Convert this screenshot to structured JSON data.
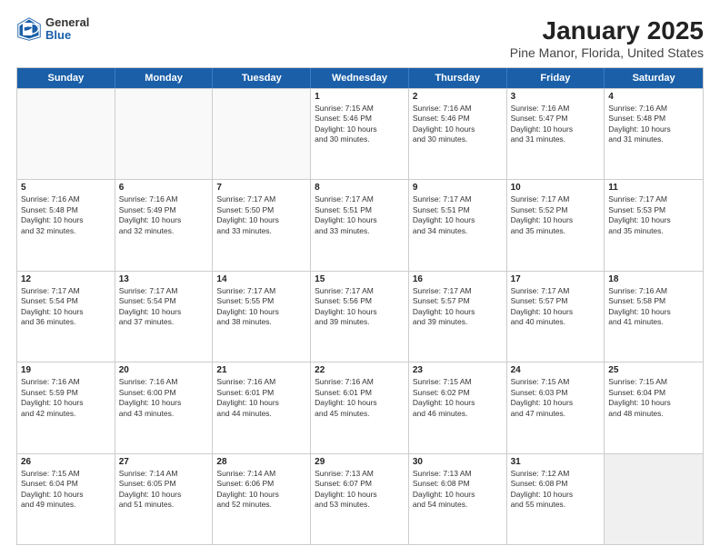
{
  "logo": {
    "general": "General",
    "blue": "Blue"
  },
  "header": {
    "title": "January 2025",
    "subtitle": "Pine Manor, Florida, United States"
  },
  "days": [
    "Sunday",
    "Monday",
    "Tuesday",
    "Wednesday",
    "Thursday",
    "Friday",
    "Saturday"
  ],
  "rows": [
    [
      {
        "day": "",
        "lines": []
      },
      {
        "day": "",
        "lines": []
      },
      {
        "day": "",
        "lines": []
      },
      {
        "day": "1",
        "lines": [
          "Sunrise: 7:15 AM",
          "Sunset: 5:46 PM",
          "Daylight: 10 hours",
          "and 30 minutes."
        ]
      },
      {
        "day": "2",
        "lines": [
          "Sunrise: 7:16 AM",
          "Sunset: 5:46 PM",
          "Daylight: 10 hours",
          "and 30 minutes."
        ]
      },
      {
        "day": "3",
        "lines": [
          "Sunrise: 7:16 AM",
          "Sunset: 5:47 PM",
          "Daylight: 10 hours",
          "and 31 minutes."
        ]
      },
      {
        "day": "4",
        "lines": [
          "Sunrise: 7:16 AM",
          "Sunset: 5:48 PM",
          "Daylight: 10 hours",
          "and 31 minutes."
        ]
      }
    ],
    [
      {
        "day": "5",
        "lines": [
          "Sunrise: 7:16 AM",
          "Sunset: 5:48 PM",
          "Daylight: 10 hours",
          "and 32 minutes."
        ]
      },
      {
        "day": "6",
        "lines": [
          "Sunrise: 7:16 AM",
          "Sunset: 5:49 PM",
          "Daylight: 10 hours",
          "and 32 minutes."
        ]
      },
      {
        "day": "7",
        "lines": [
          "Sunrise: 7:17 AM",
          "Sunset: 5:50 PM",
          "Daylight: 10 hours",
          "and 33 minutes."
        ]
      },
      {
        "day": "8",
        "lines": [
          "Sunrise: 7:17 AM",
          "Sunset: 5:51 PM",
          "Daylight: 10 hours",
          "and 33 minutes."
        ]
      },
      {
        "day": "9",
        "lines": [
          "Sunrise: 7:17 AM",
          "Sunset: 5:51 PM",
          "Daylight: 10 hours",
          "and 34 minutes."
        ]
      },
      {
        "day": "10",
        "lines": [
          "Sunrise: 7:17 AM",
          "Sunset: 5:52 PM",
          "Daylight: 10 hours",
          "and 35 minutes."
        ]
      },
      {
        "day": "11",
        "lines": [
          "Sunrise: 7:17 AM",
          "Sunset: 5:53 PM",
          "Daylight: 10 hours",
          "and 35 minutes."
        ]
      }
    ],
    [
      {
        "day": "12",
        "lines": [
          "Sunrise: 7:17 AM",
          "Sunset: 5:54 PM",
          "Daylight: 10 hours",
          "and 36 minutes."
        ]
      },
      {
        "day": "13",
        "lines": [
          "Sunrise: 7:17 AM",
          "Sunset: 5:54 PM",
          "Daylight: 10 hours",
          "and 37 minutes."
        ]
      },
      {
        "day": "14",
        "lines": [
          "Sunrise: 7:17 AM",
          "Sunset: 5:55 PM",
          "Daylight: 10 hours",
          "and 38 minutes."
        ]
      },
      {
        "day": "15",
        "lines": [
          "Sunrise: 7:17 AM",
          "Sunset: 5:56 PM",
          "Daylight: 10 hours",
          "and 39 minutes."
        ]
      },
      {
        "day": "16",
        "lines": [
          "Sunrise: 7:17 AM",
          "Sunset: 5:57 PM",
          "Daylight: 10 hours",
          "and 39 minutes."
        ]
      },
      {
        "day": "17",
        "lines": [
          "Sunrise: 7:17 AM",
          "Sunset: 5:57 PM",
          "Daylight: 10 hours",
          "and 40 minutes."
        ]
      },
      {
        "day": "18",
        "lines": [
          "Sunrise: 7:16 AM",
          "Sunset: 5:58 PM",
          "Daylight: 10 hours",
          "and 41 minutes."
        ]
      }
    ],
    [
      {
        "day": "19",
        "lines": [
          "Sunrise: 7:16 AM",
          "Sunset: 5:59 PM",
          "Daylight: 10 hours",
          "and 42 minutes."
        ]
      },
      {
        "day": "20",
        "lines": [
          "Sunrise: 7:16 AM",
          "Sunset: 6:00 PM",
          "Daylight: 10 hours",
          "and 43 minutes."
        ]
      },
      {
        "day": "21",
        "lines": [
          "Sunrise: 7:16 AM",
          "Sunset: 6:01 PM",
          "Daylight: 10 hours",
          "and 44 minutes."
        ]
      },
      {
        "day": "22",
        "lines": [
          "Sunrise: 7:16 AM",
          "Sunset: 6:01 PM",
          "Daylight: 10 hours",
          "and 45 minutes."
        ]
      },
      {
        "day": "23",
        "lines": [
          "Sunrise: 7:15 AM",
          "Sunset: 6:02 PM",
          "Daylight: 10 hours",
          "and 46 minutes."
        ]
      },
      {
        "day": "24",
        "lines": [
          "Sunrise: 7:15 AM",
          "Sunset: 6:03 PM",
          "Daylight: 10 hours",
          "and 47 minutes."
        ]
      },
      {
        "day": "25",
        "lines": [
          "Sunrise: 7:15 AM",
          "Sunset: 6:04 PM",
          "Daylight: 10 hours",
          "and 48 minutes."
        ]
      }
    ],
    [
      {
        "day": "26",
        "lines": [
          "Sunrise: 7:15 AM",
          "Sunset: 6:04 PM",
          "Daylight: 10 hours",
          "and 49 minutes."
        ]
      },
      {
        "day": "27",
        "lines": [
          "Sunrise: 7:14 AM",
          "Sunset: 6:05 PM",
          "Daylight: 10 hours",
          "and 51 minutes."
        ]
      },
      {
        "day": "28",
        "lines": [
          "Sunrise: 7:14 AM",
          "Sunset: 6:06 PM",
          "Daylight: 10 hours",
          "and 52 minutes."
        ]
      },
      {
        "day": "29",
        "lines": [
          "Sunrise: 7:13 AM",
          "Sunset: 6:07 PM",
          "Daylight: 10 hours",
          "and 53 minutes."
        ]
      },
      {
        "day": "30",
        "lines": [
          "Sunrise: 7:13 AM",
          "Sunset: 6:08 PM",
          "Daylight: 10 hours",
          "and 54 minutes."
        ]
      },
      {
        "day": "31",
        "lines": [
          "Sunrise: 7:12 AM",
          "Sunset: 6:08 PM",
          "Daylight: 10 hours",
          "and 55 minutes."
        ]
      },
      {
        "day": "",
        "lines": []
      }
    ]
  ]
}
